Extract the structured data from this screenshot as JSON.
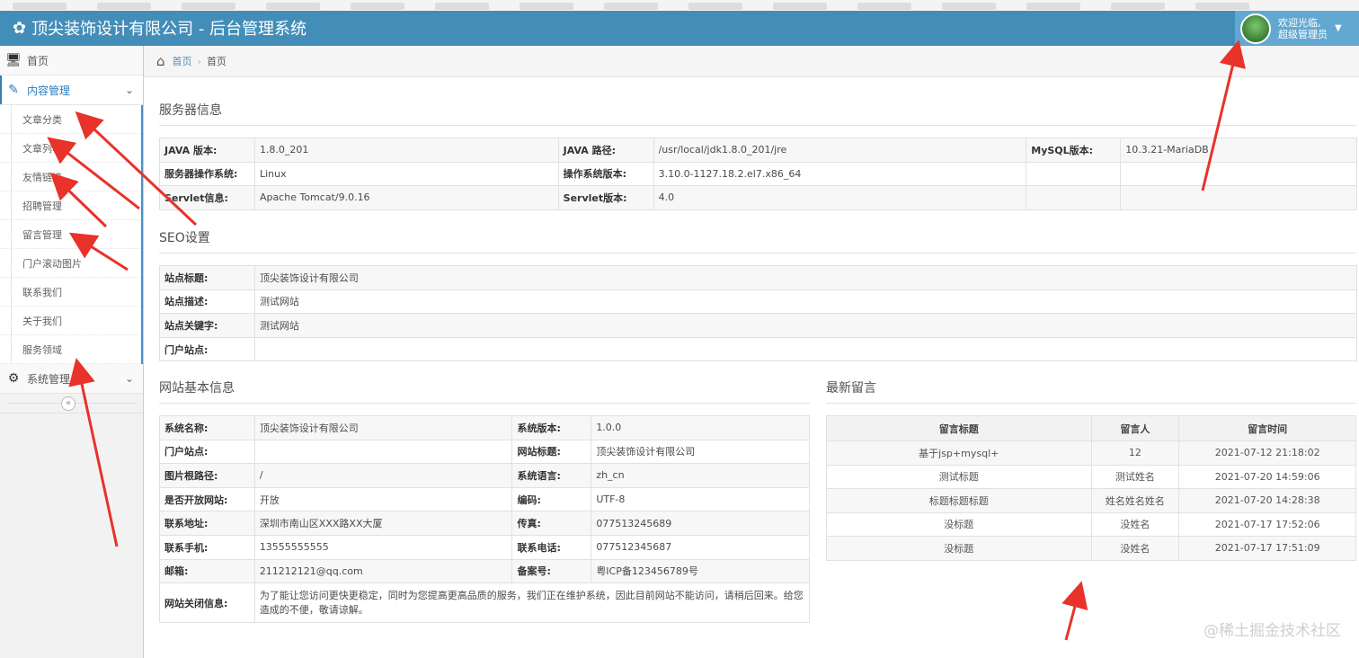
{
  "header": {
    "brand_title": "顶尖装饰设计有限公司 - 后台管理系统",
    "welcome_line1": "欢迎光临,",
    "welcome_line2": "超级管理员"
  },
  "sidebar": {
    "home": "首页",
    "content_mgmt": "内容管理",
    "content_items": [
      "文章分类",
      "文章列表",
      "友情链接",
      "招聘管理",
      "留言管理",
      "门户滚动图片",
      "联系我们",
      "关于我们",
      "服务领域"
    ],
    "system_mgmt": "系统管理"
  },
  "breadcrumb": {
    "home": "首页",
    "current": "首页"
  },
  "server_info": {
    "title": "服务器信息",
    "rows": [
      [
        "JAVA 版本:",
        "1.8.0_201",
        "JAVA 路径:",
        "/usr/local/jdk1.8.0_201/jre",
        "MySQL版本:",
        "10.3.21-MariaDB"
      ],
      [
        "服务器操作系统:",
        "Linux",
        "操作系统版本:",
        "3.10.0-1127.18.2.el7.x86_64",
        "",
        ""
      ],
      [
        "Servlet信息:",
        "Apache Tomcat/9.0.16",
        "Servlet版本:",
        "4.0",
        "",
        ""
      ]
    ]
  },
  "seo": {
    "title": "SEO设置",
    "rows": [
      [
        "站点标题:",
        "顶尖装饰设计有限公司"
      ],
      [
        "站点描述:",
        "测试网站"
      ],
      [
        "站点关键字:",
        "测试网站"
      ],
      [
        "门户站点:",
        ""
      ]
    ]
  },
  "site_info": {
    "title": "网站基本信息",
    "rows": [
      [
        "系统名称:",
        "顶尖装饰设计有限公司",
        "系统版本:",
        "1.0.0"
      ],
      [
        "门户站点:",
        "",
        "网站标题:",
        "顶尖装饰设计有限公司"
      ],
      [
        "图片根路径:",
        "/",
        "系统语言:",
        "zh_cn"
      ],
      [
        "是否开放网站:",
        "开放",
        "编码:",
        "UTF-8"
      ],
      [
        "联系地址:",
        "深圳市南山区XXX路XX大厦",
        "传真:",
        "077513245689"
      ],
      [
        "联系手机:",
        "13555555555",
        "联系电话:",
        "077512345687"
      ],
      [
        "邮箱:",
        "211212121@qq.com",
        "备案号:",
        "粤ICP备123456789号"
      ]
    ],
    "close_label": "网站关闭信息:",
    "close_text": "为了能让您访问更快更稳定，同时为您提高更高品质的服务，我们正在维护系统，因此目前网站不能访问，请稍后回来。给您造成的不便，敬请谅解。"
  },
  "messages": {
    "title": "最新留言",
    "headers": [
      "留言标题",
      "留言人",
      "留言时间"
    ],
    "rows": [
      [
        "基于jsp+mysql+",
        "12",
        "2021-07-12 21:18:02"
      ],
      [
        "测试标题",
        "测试姓名",
        "2021-07-20 14:59:06"
      ],
      [
        "标题标题标题",
        "姓名姓名姓名",
        "2021-07-20 14:28:38"
      ],
      [
        "没标题",
        "没姓名",
        "2021-07-17 17:52:06"
      ],
      [
        "没标题",
        "没姓名",
        "2021-07-17 17:51:09"
      ]
    ]
  },
  "watermark": "@稀土掘金技术社区",
  "colors": {
    "navbar": "#438eb9",
    "accent": "#2b7dbc",
    "annotation": "#e8322a"
  }
}
